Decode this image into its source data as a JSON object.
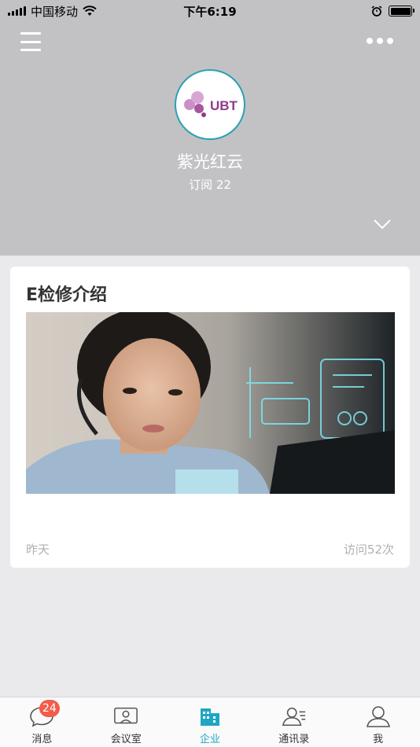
{
  "status_bar": {
    "carrier": "中国移动",
    "time": "下午6:19"
  },
  "header": {
    "logo_text": "UBT",
    "company_name": "紫光红云",
    "subscribe_text": "订阅 22"
  },
  "article": {
    "title": "E检修介绍",
    "date": "昨天",
    "visits": "访问52次"
  },
  "tabs": [
    {
      "label": "消息",
      "icon": "message-icon",
      "badge": "24"
    },
    {
      "label": "会议室",
      "icon": "meeting-room-icon"
    },
    {
      "label": "企业",
      "icon": "enterprise-icon"
    },
    {
      "label": "通讯录",
      "icon": "contacts-icon"
    },
    {
      "label": "我",
      "icon": "profile-icon"
    }
  ],
  "colors": {
    "header_bg": "#c2c2c4",
    "accent": "#1fa6c4",
    "badge": "#f25c4a",
    "logo_purple": "#8e3a8c"
  }
}
